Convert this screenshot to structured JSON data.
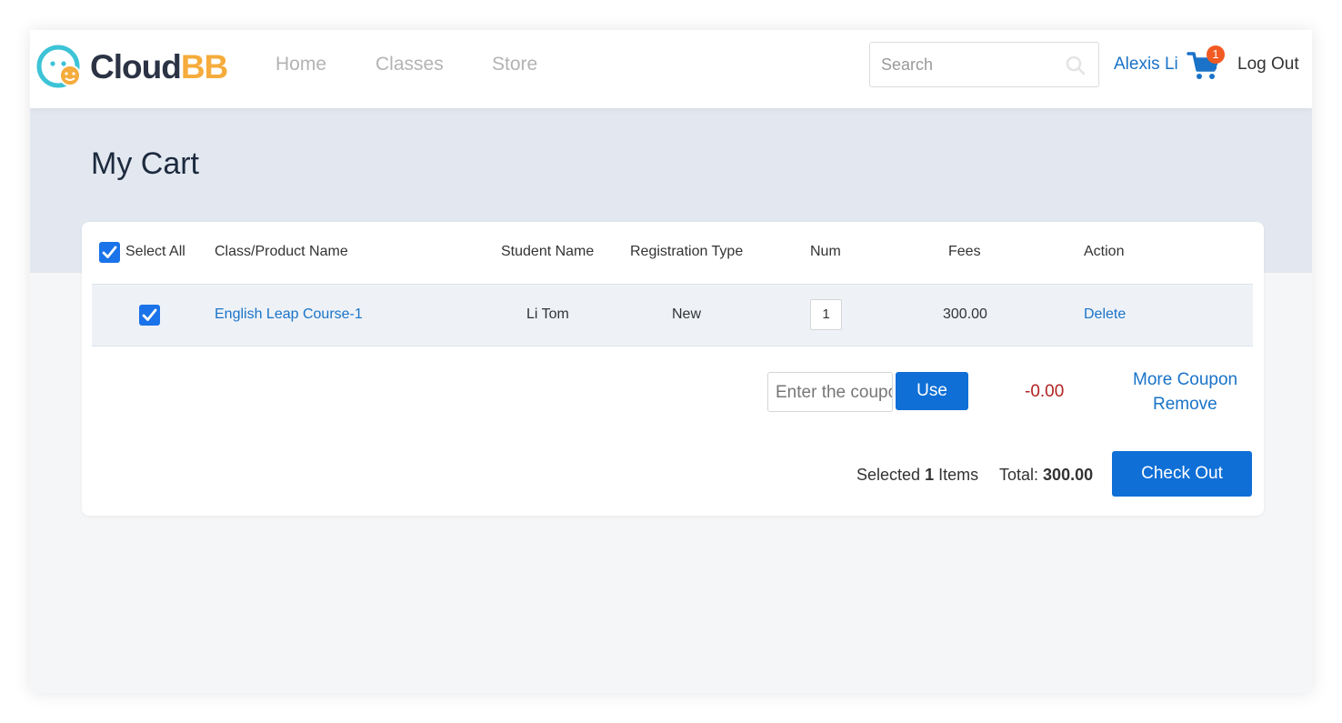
{
  "header": {
    "logo": {
      "part1": "Cloud",
      "part2": "BB"
    },
    "nav": [
      "Home",
      "Classes",
      "Store"
    ],
    "search": {
      "placeholder": "Search",
      "value": ""
    },
    "user_name": "Alexis Li",
    "cart_count": "1",
    "logout_label": "Log Out"
  },
  "page": {
    "title": "My Cart"
  },
  "table": {
    "select_all_label": "Select All",
    "select_all_checked": true,
    "columns": [
      "Class/Product Name",
      "Student Name",
      "Registration Type",
      "Num",
      "Fees",
      "Action"
    ],
    "rows": [
      {
        "checked": true,
        "name": "English Leap Course-1",
        "student": "Li Tom",
        "registration_type": "New",
        "num": "1",
        "fees": "300.00",
        "action": "Delete"
      }
    ]
  },
  "coupon": {
    "placeholder": "Enter the coupon",
    "use_label": "Use",
    "discount": "-0.00",
    "more_label": "More Coupon",
    "remove_label": "Remove"
  },
  "summary": {
    "selected_prefix": "Selected",
    "selected_count": "1",
    "selected_suffix": "Items",
    "total_label": "Total:",
    "total_value": "300.00",
    "checkout_label": "Check Out"
  },
  "colors": {
    "accent": "#0f6fd6",
    "link": "#1a73c8",
    "discount": "#b22222",
    "badge": "#f15a22",
    "band": "#e3e8f0"
  }
}
